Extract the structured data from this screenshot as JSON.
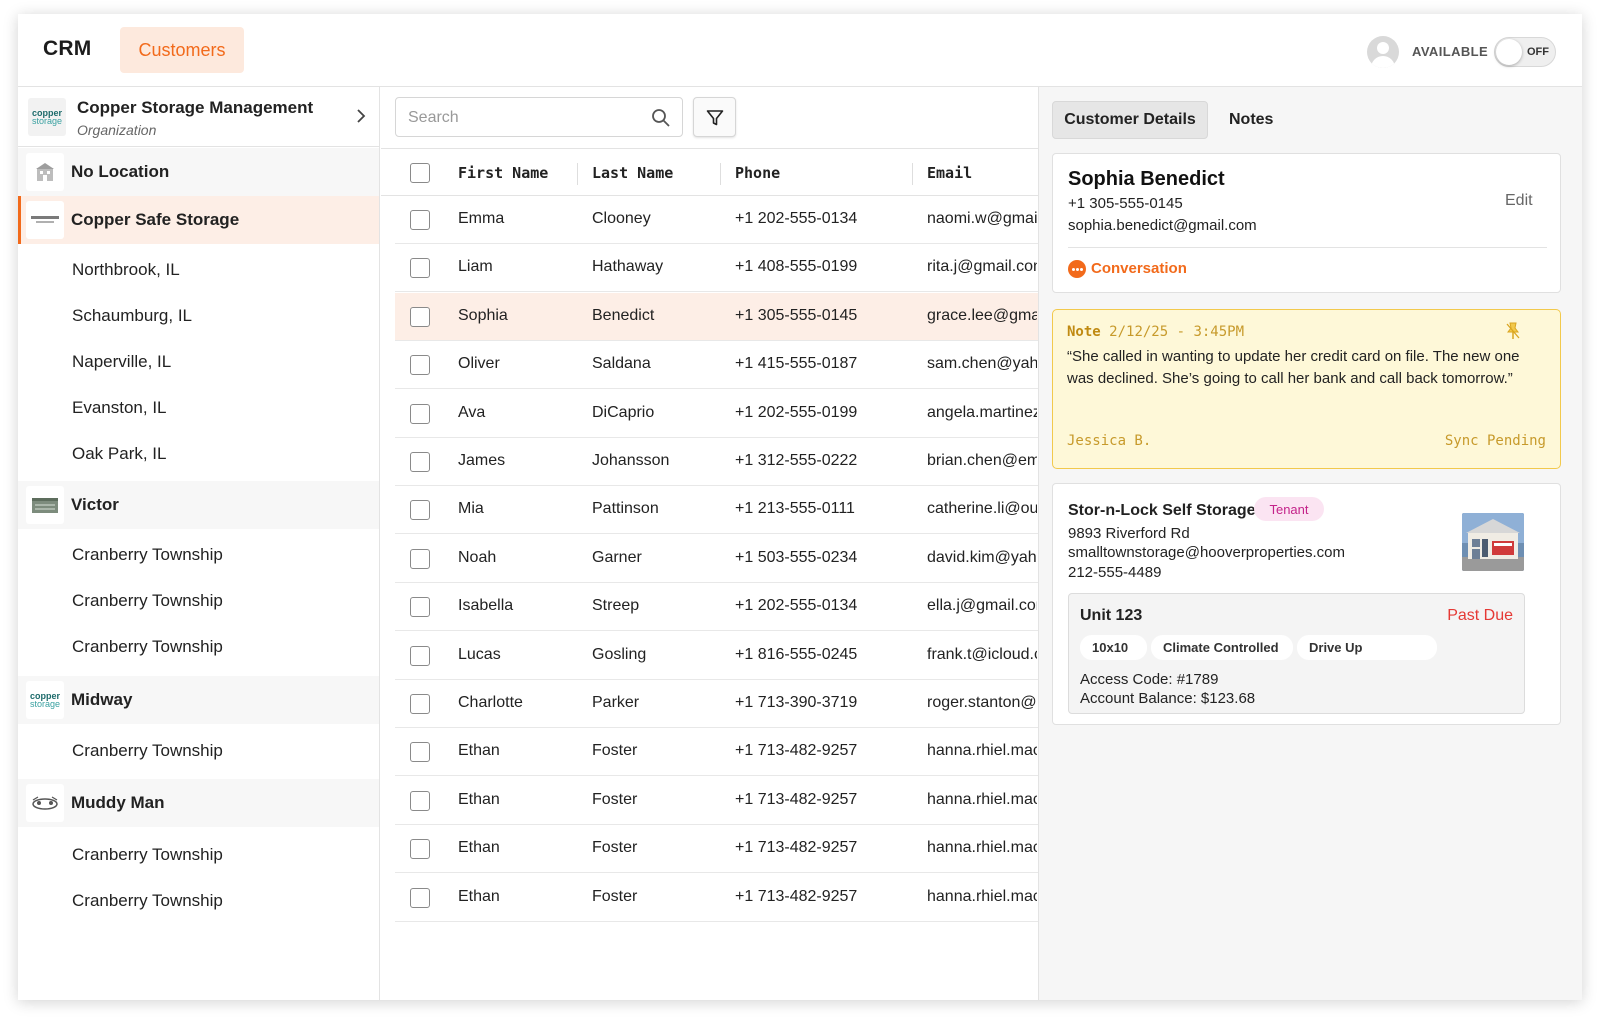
{
  "header": {
    "brand": "CRM",
    "active_tab": "Customers",
    "availability_label": "AVAILABLE",
    "toggle_label": "OFF",
    "toggle_on": false
  },
  "sidebar": {
    "org_name": "Copper Storage Management",
    "org_subtitle": "Organization",
    "logo_text_top": "copper",
    "logo_text_bottom": "storage",
    "groups": [
      {
        "name": "No Location",
        "children": []
      },
      {
        "name": "Copper Safe Storage",
        "active": true,
        "children": [
          "Northbrook, IL",
          "Schaumburg, IL",
          "Naperville, IL",
          "Evanston, IL",
          "Oak Park, IL"
        ]
      },
      {
        "name": "Victor",
        "children": [
          "Cranberry Township",
          "Cranberry Township",
          "Cranberry Township"
        ]
      },
      {
        "name": "Midway",
        "children": [
          "Cranberry Township"
        ]
      },
      {
        "name": "Muddy Man",
        "children": [
          "Cranberry Township",
          "Cranberry Township"
        ]
      }
    ]
  },
  "table": {
    "search_placeholder": "Search",
    "columns": [
      "First Name",
      "Last Name",
      "Phone",
      "Email"
    ],
    "rows": [
      {
        "first": "Emma",
        "last": "Clooney",
        "phone": "+1 202-555-0134",
        "email": "naomi.w@gmail.com"
      },
      {
        "first": "Liam",
        "last": "Hathaway",
        "phone": "+1 408-555-0199",
        "email": "rita.j@gmail.com"
      },
      {
        "first": "Sophia",
        "last": "Benedict",
        "phone": "+1 305-555-0145",
        "email": "grace.lee@gmail.com",
        "selected": true
      },
      {
        "first": "Oliver",
        "last": "Saldana",
        "phone": "+1 415-555-0187",
        "email": "sam.chen@yahoo.com"
      },
      {
        "first": "Ava",
        "last": "DiCaprio",
        "phone": "+1 202-555-0199",
        "email": "angela.martinez@gmail.com"
      },
      {
        "first": "James",
        "last": "Johansson",
        "phone": "+1 312-555-0222",
        "email": "brian.chen@email.com"
      },
      {
        "first": "Mia",
        "last": "Pattinson",
        "phone": "+1 213-555-0111",
        "email": "catherine.li@outlook.com"
      },
      {
        "first": "Noah",
        "last": "Garner",
        "phone": "+1 503-555-0234",
        "email": "david.kim@yahoo.com"
      },
      {
        "first": "Isabella",
        "last": "Streep",
        "phone": "+1 202-555-0134",
        "email": "ella.j@gmail.com"
      },
      {
        "first": "Lucas",
        "last": "Gosling",
        "phone": "+1 816-555-0245",
        "email": "frank.t@icloud.com"
      },
      {
        "first": "Charlotte",
        "last": "Parker",
        "phone": "+1 713-390-3719",
        "email": "roger.stanton@gmail.com"
      },
      {
        "first": "Ethan",
        "last": "Foster",
        "phone": "+1 713-482-9257",
        "email": "hanna.rhiel.mac@gmail.com"
      },
      {
        "first": "Ethan",
        "last": "Foster",
        "phone": "+1 713-482-9257",
        "email": "hanna.rhiel.mac@gmail.com"
      },
      {
        "first": "Ethan",
        "last": "Foster",
        "phone": "+1 713-482-9257",
        "email": "hanna.rhiel.mac@gmail.com"
      },
      {
        "first": "Ethan",
        "last": "Foster",
        "phone": "+1 713-482-9257",
        "email": "hanna.rhiel.mac@gmail.com"
      }
    ]
  },
  "details": {
    "tabs": [
      "Customer Details",
      "Notes"
    ],
    "customer": {
      "name": "Sophia Benedict",
      "phone": "+1 305-555-0145",
      "email": "sophia.benedict@gmail.com",
      "edit_label": "Edit",
      "conversation_label": "Conversation"
    },
    "note": {
      "label": "Note",
      "datetime": "2/12/25 - 3:45PM",
      "text": "“She called in wanting to update her credit card on file. The new one was declined. She’s going to call her bank and call back tomorrow.”",
      "author": "Jessica B.",
      "status": "Sync Pending"
    },
    "property": {
      "name": "Stor-n-Lock Self Storage",
      "badge": "Tenant",
      "address": "9893 Riverford Rd",
      "email": "smalltownstorage@hooverproperties.com",
      "phone": "212-555-4489",
      "unit": {
        "name": "Unit 123",
        "status": "Past Due",
        "tags": [
          "10x10",
          "Climate Controlled",
          "Drive Up"
        ],
        "access_code": "Access Code: #1789",
        "balance": "Account Balance: $123.68"
      }
    }
  },
  "colors": {
    "accent": "#f26a1b",
    "accent_bg": "#fdeee6",
    "note_bg": "#fef8d8",
    "note_border": "#f2c94c",
    "past_due": "#e53935",
    "tenant_badge_bg": "#fbe4f2",
    "tenant_badge_fg": "#c4238a"
  }
}
